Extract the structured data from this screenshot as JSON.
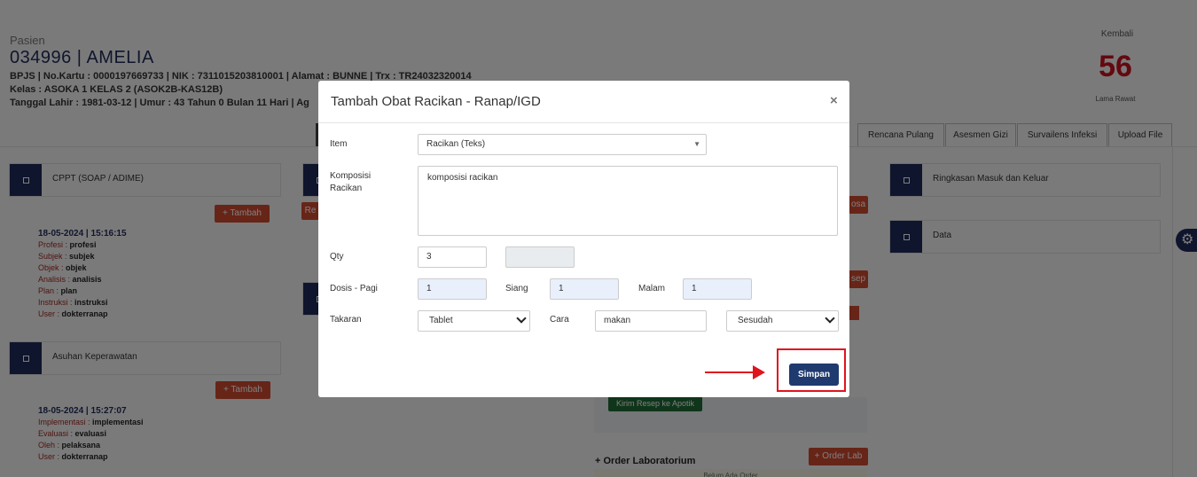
{
  "patient": {
    "label": "Pasien",
    "id_name": "034996 | AMELIA",
    "line1": "BPJS | No.Kartu : 0000197669733 | NIK : 7311015203810001 | Alamat : BUNNE | Trx : TR24032320014",
    "line2": "Kelas : ASOKA 1 KELAS 2 (ASOK2B-KAS12B)",
    "line3": "Tanggal Lahir : 1981-03-12 | Umur : 43 Tahun 0 Bulan 11 Hari | Ag"
  },
  "stay": {
    "kembali": "Kembali",
    "days": "56",
    "days_label": "Lama Rawat"
  },
  "tabs": [
    "Rencana Pulang",
    "Asesmen Gizi",
    "Survailens Infeksi",
    "Upload File"
  ],
  "left_cards": {
    "cppt": {
      "title": "CPPT (SOAP / ADIME)",
      "add_label": "+ Tambah"
    },
    "asuhan": {
      "title": "Asuhan Keperawatan",
      "add_label": "+ Tambah"
    }
  },
  "cppt_entry": {
    "datetime": "18-05-2024 | 15:16:15",
    "rows": [
      {
        "k": "Profesi : ",
        "v": "profesi"
      },
      {
        "k": "Subjek : ",
        "v": "subjek"
      },
      {
        "k": "Objek : ",
        "v": "objek"
      },
      {
        "k": "Analisis : ",
        "v": "analisis"
      },
      {
        "k": "Plan : ",
        "v": "plan"
      },
      {
        "k": "Instruksi : ",
        "v": "instruksi"
      },
      {
        "k": "User : ",
        "v": "dokterranap"
      }
    ]
  },
  "asuhan_entry": {
    "datetime": "18-05-2024 | 15:27:07",
    "rows": [
      {
        "k": "Implementasi : ",
        "v": "implementasi"
      },
      {
        "k": "Evaluasi : ",
        "v": "evaluasi"
      },
      {
        "k": "Oleh : ",
        "v": "pelaksana"
      },
      {
        "k": "User : ",
        "v": "dokterranap"
      }
    ]
  },
  "right_cards": [
    "Ringkasan Masuk dan Keluar",
    "Data"
  ],
  "middle": {
    "partial_re": "Re",
    "partial_osa": "osa",
    "partial_sep": "sep",
    "kirim_resep": "Kirim Resep ke Apotik",
    "order_lab_title": "+ Order Laboratorium",
    "order_lab_btn": "+ Order Lab",
    "belum_ada": "Belum Ada Order"
  },
  "modal": {
    "title": "Tambah Obat Racikan - Ranap/IGD",
    "close": "×",
    "item_label": "Item",
    "item_value": "Racikan (Teks)",
    "komposisi_label": "Komposisi Racikan",
    "komposisi_value": "komposisi racikan",
    "qty_label": "Qty",
    "qty_value": "3",
    "qty_extra": "",
    "dosis_label": "Dosis - Pagi",
    "pagi_value": "1",
    "siang_label": "Siang",
    "siang_value": "1",
    "malam_label": "Malam",
    "malam_value": "1",
    "takaran_label": "Takaran",
    "takaran_value": "Tablet",
    "cara_label": "Cara",
    "cara_value": "makan",
    "waktu_value": "Sesudah",
    "save_label": "Simpan"
  },
  "colors": {
    "primary": "#1f2b59",
    "danger": "#cf4a31",
    "highlight": "#e0141e",
    "success": "#1e6b34"
  }
}
